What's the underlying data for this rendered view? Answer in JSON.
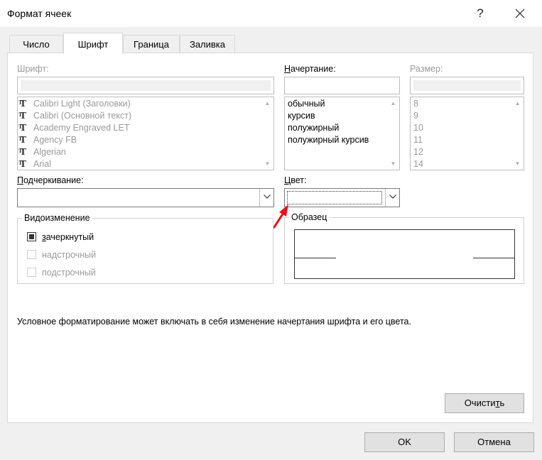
{
  "window": {
    "title": "Формат ячеек",
    "help": "?",
    "close": "✕"
  },
  "tabs": [
    {
      "label": "Число"
    },
    {
      "label": "Шрифт"
    },
    {
      "label": "Граница"
    },
    {
      "label": "Заливка"
    }
  ],
  "font": {
    "label": "Шрифт:",
    "items": [
      "Calibri Light (Заголовки)",
      "Calibri (Основной текст)",
      "Academy Engraved LET",
      "Agency FB",
      "Algerian",
      "Arial"
    ]
  },
  "style": {
    "label_prefix": "Н",
    "label_rest": "ачертание:",
    "items": [
      "обычный",
      "курсив",
      "полужирный",
      "полужирный курсив"
    ]
  },
  "size": {
    "label": "Размер:",
    "items": [
      "8",
      "9",
      "10",
      "11",
      "12",
      "14"
    ]
  },
  "underline": {
    "label_prefix": "П",
    "label_rest": "одчеркивание:"
  },
  "color": {
    "label_prefix": "Ц",
    "label_rest": "вет:"
  },
  "effects": {
    "title": "Видоизменение",
    "strikethrough": {
      "label_prefix": "з",
      "label_rest": "ачеркнутый"
    },
    "superscript": "надстрочный",
    "subscript": "подстрочный"
  },
  "preview": {
    "title": "Образец"
  },
  "note": "Условное форматирование может включать в себя изменение начертания шрифта и его цвета.",
  "buttons": {
    "clear_prefix": "Очисти",
    "clear_u": "т",
    "clear_suffix": "ь",
    "ok": "OK",
    "cancel": "Отмена"
  },
  "colors": {
    "accent_red": "#e8141b"
  }
}
